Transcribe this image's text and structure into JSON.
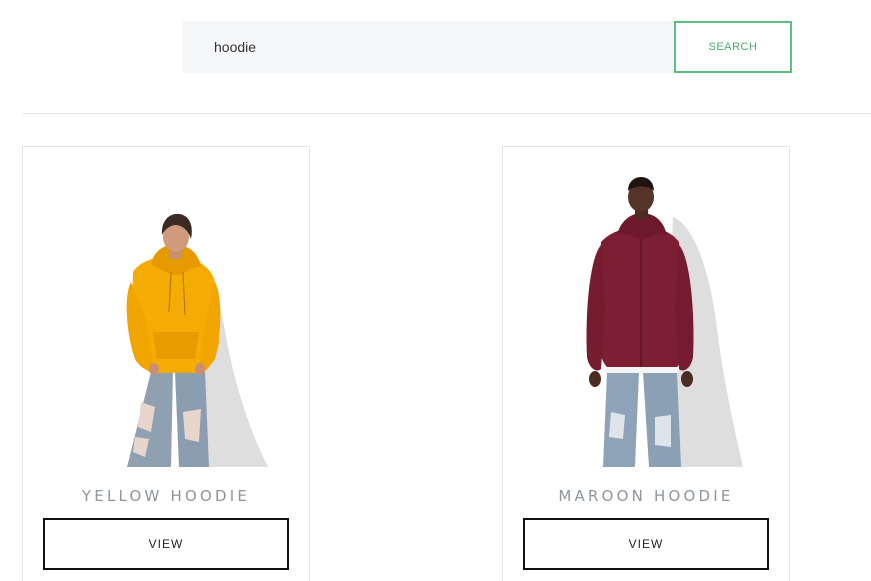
{
  "search": {
    "query": "hoodie",
    "button_label": "SEARCH"
  },
  "products": [
    {
      "title": "YELLOW HOODIE",
      "view_label": "VIEW",
      "garment_color": "#f5ad05"
    },
    {
      "title": "MAROON HOODIE",
      "view_label": "VIEW",
      "garment_color": "#7d1f33"
    }
  ],
  "colors": {
    "accent": "#5bbf7d"
  }
}
